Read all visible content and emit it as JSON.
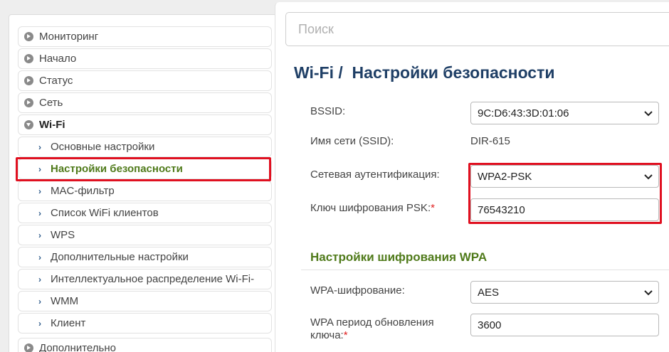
{
  "sidebar": {
    "items": [
      {
        "label": "Мониторинг"
      },
      {
        "label": "Начало"
      },
      {
        "label": "Статус"
      },
      {
        "label": "Сеть"
      },
      {
        "label": "Wi-Fi"
      },
      {
        "label": "Основные настройки"
      },
      {
        "label": "Настройки безопасности"
      },
      {
        "label": "MAC-фильтр"
      },
      {
        "label": "Список WiFi клиентов"
      },
      {
        "label": "WPS"
      },
      {
        "label": "Дополнительные настройки"
      },
      {
        "label": "Интеллектуальное распределение Wi-Fi-"
      },
      {
        "label": "WMM"
      },
      {
        "label": "Клиент"
      },
      {
        "label": "Дополнительно"
      }
    ]
  },
  "search": {
    "placeholder": "Поиск"
  },
  "page": {
    "title": "Wi-Fi /  Настройки безопасности"
  },
  "form": {
    "bssid": {
      "label": "BSSID:",
      "value": "9C:D6:43:3D:01:06"
    },
    "ssid": {
      "label": "Имя сети (SSID):",
      "value": "DIR-615"
    },
    "auth": {
      "label": "Сетевая аутентификация:",
      "value": "WPA2-PSK"
    },
    "psk": {
      "label": "Ключ шифрования PSK:",
      "required": "*",
      "value": "76543210"
    },
    "section_title": "Настройки шифрования WPA",
    "wpa_enc": {
      "label": "WPA-шифрование:",
      "value": "AES"
    },
    "wpa_period": {
      "label_line1": "WPA период обновления",
      "label_line2": "ключа:",
      "required": "*",
      "value": "3600"
    }
  },
  "colors": {
    "title": "#1f3f66",
    "section": "#4f7a1a",
    "highlight": "#e01020",
    "required": "#e02020"
  },
  "icons": {
    "collapsed": "circle-arrow-right-icon",
    "expanded": "circle-arrow-down-icon",
    "sub": "chevron-right-icon",
    "select": "chevron-down-icon"
  }
}
